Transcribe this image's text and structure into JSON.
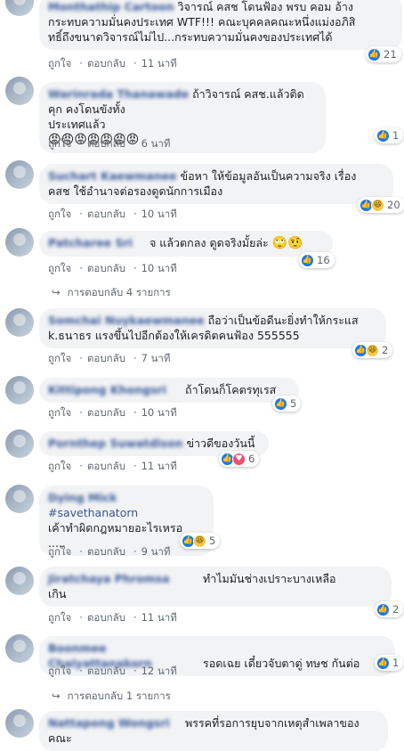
{
  "actions": {
    "like": "ถูกใจ",
    "reply": "ตอบกลับ",
    "dot": "·"
  },
  "comments": [
    {
      "name": "Monthathip Cartoon",
      "text": "วิจารณ์ คสช โดนฟ้อง พรบ คอม อ้าง\nกระทบความมั่นคงประเทศ WTF!!! คณะบุคคลคณะหนึ่งแม่งอภิสิ\nทธิ์ถึงขนาดวิจารณ์ไม่ไป...กระทบความมั่นคงของประเทศได้",
      "time": "11 นาที",
      "reacts": "21"
    },
    {
      "name": "Warinrada Thanawade",
      "text": "ถ้าวิจารณ์ คสช.แล้วติดคุก คงโดนขังทั้ง\nประเทศแล้ว",
      "emoji": "😡😡😡😡😡😡😡",
      "time": "6 นาที",
      "reacts": "1"
    },
    {
      "name": "Suchart Kaewmanee",
      "text": "ข้อหา ให้ข้อมูลอันเป็นความจริง เรื่อง\nคสช ใช้อำนาจต่อรองดูดนักการเมือง",
      "time": "10 นาที",
      "reacts": "20"
    },
    {
      "name": "Patcharee Sri",
      "text": "จ แล้วตกลง ดูดจริงมั้ยล่ะ",
      "emoji": "🙄🤨",
      "time": "10 นาที",
      "reacts": "16"
    },
    {
      "name": "Somchai Nuykaewmanee",
      "text": "ถือว่าเป็นข้อดีนะยิ่งทำให้กระแส\nk.ธนาธร แรงขึ้นไปอีกต้องให้เครดิตคนฟ้อง 555555",
      "time": "7 นาที",
      "reacts": "2"
    },
    {
      "name": "Kittipong Khongsri",
      "text": "ถ้าโดนก็โคตรทุเรส",
      "time": "10 นาที",
      "reacts": "5"
    },
    {
      "name": "Pornthep Suwatdison",
      "text": "ข่าวดีของวันนี้",
      "time": "11 นาที",
      "reacts": "6"
    },
    {
      "name": "Dying Mick",
      "tag": "#savethanatorn",
      "text": "เค้าทำผิดกฎหมายอะไรเหรอ\n.....",
      "time": "9 นาที",
      "reacts": "5"
    },
    {
      "name": "Jiratchaya Phromsa",
      "text": "ทำไมมันช่างเปราะบางเหลือ\nเกิน",
      "time": "11 นาที",
      "reacts": "2"
    },
    {
      "name": "Boonmee Chaiyattanakorn",
      "text": "รอดเฉย เดี๋ยวจับตาตู่ ทษช กันต่อ",
      "time": "12 นาที",
      "reacts": "1"
    },
    {
      "name": "Nattapong Wongsri",
      "text": "พรรคที่รอการยุบจากเหตุสำเพลาของ\nคณะ"
    }
  ],
  "replies": [
    {
      "label": "การตอบกลับ 4 รายการ"
    },
    {
      "label": "การตอบกลับ 1 รายการ"
    }
  ]
}
